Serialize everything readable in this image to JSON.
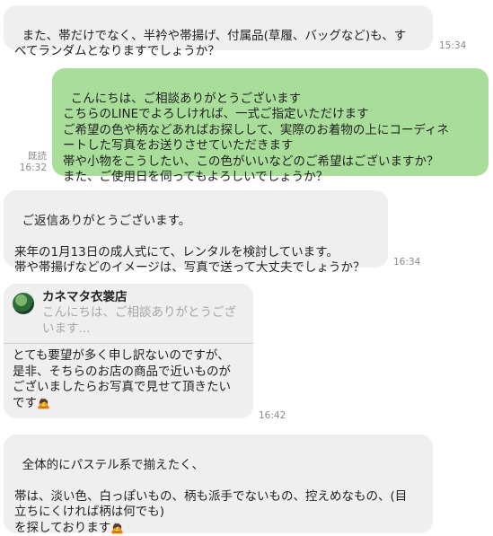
{
  "messages": [
    {
      "text": "また、帯だけでなく、半衿や帯揚げ、付属品(草履、バッグなど)も、す\nべてランダムとなりますでしょうか？",
      "time": "15:34"
    },
    {
      "text": "こんにちは、ご相談ありがとうございます\nこちらのLINEでよろしければ、一式ご指定いただけます\nご希望の色や柄などあればお探しして、実際のお着物の上にコーディネ\nートした写真をお送りさせていただきます\n帯や小物をこうしたい、この色がいいなどのご希望はございますか？\nまた、ご使用日を伺ってもよろしいでしょうか？",
      "read": "既読",
      "time": "16:32"
    },
    {
      "text": "ご返信ありがとうございます。\n\n来年の1月13日の成人式にて、レンタルを検討しています。\n帯や帯揚げなどのイメージは、写真で送って大丈夫でしょうか？",
      "time": "16:34"
    },
    {
      "quote_name": "カネマタ衣裳店",
      "quote_text": "こんにちは、ご相談ありがとうござ\nいます...",
      "text": "とても要望が多く申し訳ないのですが、\n是非、そちらのお店の商品で近いものが\nございましたらお写真で見せて頂きたい\nです",
      "emoji": "🙇",
      "time": "16:42"
    },
    {
      "text": "全体的にパステル系で揃えたく、\n\n帯は、淡い色、白っぽいもの、柄も派手でないもの、控えめなもの、(目\n立ちにくければ柄は何でも)\nを探しております",
      "emoji": "🙇"
    }
  ],
  "colors": {
    "incoming": "#efefef",
    "outgoing": "#a8dd9a",
    "meta": "#8a8a8a"
  }
}
